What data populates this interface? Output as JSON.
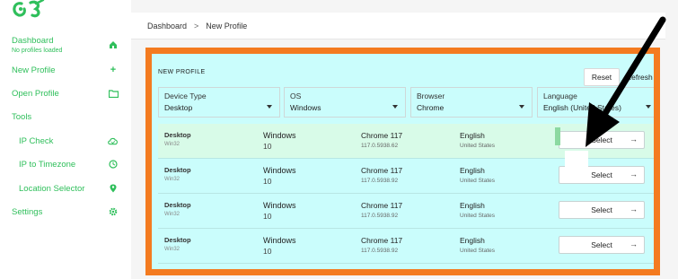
{
  "sidebar": {
    "dashboard_label": "Dashboard",
    "dashboard_sub": "No profiles loaded",
    "items": [
      {
        "label": "New Profile",
        "icon": "plus-icon"
      },
      {
        "label": "Open Profile",
        "icon": "folder-icon"
      },
      {
        "label": "Tools",
        "icon": ""
      },
      {
        "label": "IP Check",
        "icon": "cloud-check-icon"
      },
      {
        "label": "IP to Timezone",
        "icon": "clock-icon"
      },
      {
        "label": "Location Selector",
        "icon": "map-pin-icon"
      },
      {
        "label": "Settings",
        "icon": "gear-icon"
      }
    ],
    "accent_color": "#2fbf5b"
  },
  "breadcrumb": {
    "root": "Dashboard",
    "separator": ">",
    "current": "New Profile"
  },
  "panel": {
    "title": "NEW PROFILE",
    "reset_label": "Reset",
    "refresh_label": "Refresh",
    "filters": [
      {
        "label": "Device Type",
        "value": "Desktop"
      },
      {
        "label": "OS",
        "value": "Windows"
      },
      {
        "label": "Browser",
        "value": "Chrome"
      },
      {
        "label": "Language",
        "value": "English (United States)"
      }
    ],
    "rows": [
      {
        "device": "Desktop",
        "platform": "Win32",
        "os": "Windows",
        "os_version": "10",
        "browser": "Chrome 117",
        "browser_version": "117.0.5938.62",
        "language": "English",
        "region": "United States",
        "select_label": "Select"
      },
      {
        "device": "Desktop",
        "platform": "Win32",
        "os": "Windows",
        "os_version": "10",
        "browser": "Chrome 117",
        "browser_version": "117.0.5938.92",
        "language": "English",
        "region": "United States",
        "select_label": "Select"
      },
      {
        "device": "Desktop",
        "platform": "Win32",
        "os": "Windows",
        "os_version": "10",
        "browser": "Chrome 117",
        "browser_version": "117.0.5938.92",
        "language": "English",
        "region": "United States",
        "select_label": "Select"
      },
      {
        "device": "Desktop",
        "platform": "Win32",
        "os": "Windows",
        "os_version": "10",
        "browser": "Chrome 117",
        "browser_version": "117.0.5938.92",
        "language": "English",
        "region": "United States",
        "select_label": "Select"
      }
    ]
  },
  "colors": {
    "highlight_border": "#f47b20",
    "panel_background": "#cafdfc"
  }
}
